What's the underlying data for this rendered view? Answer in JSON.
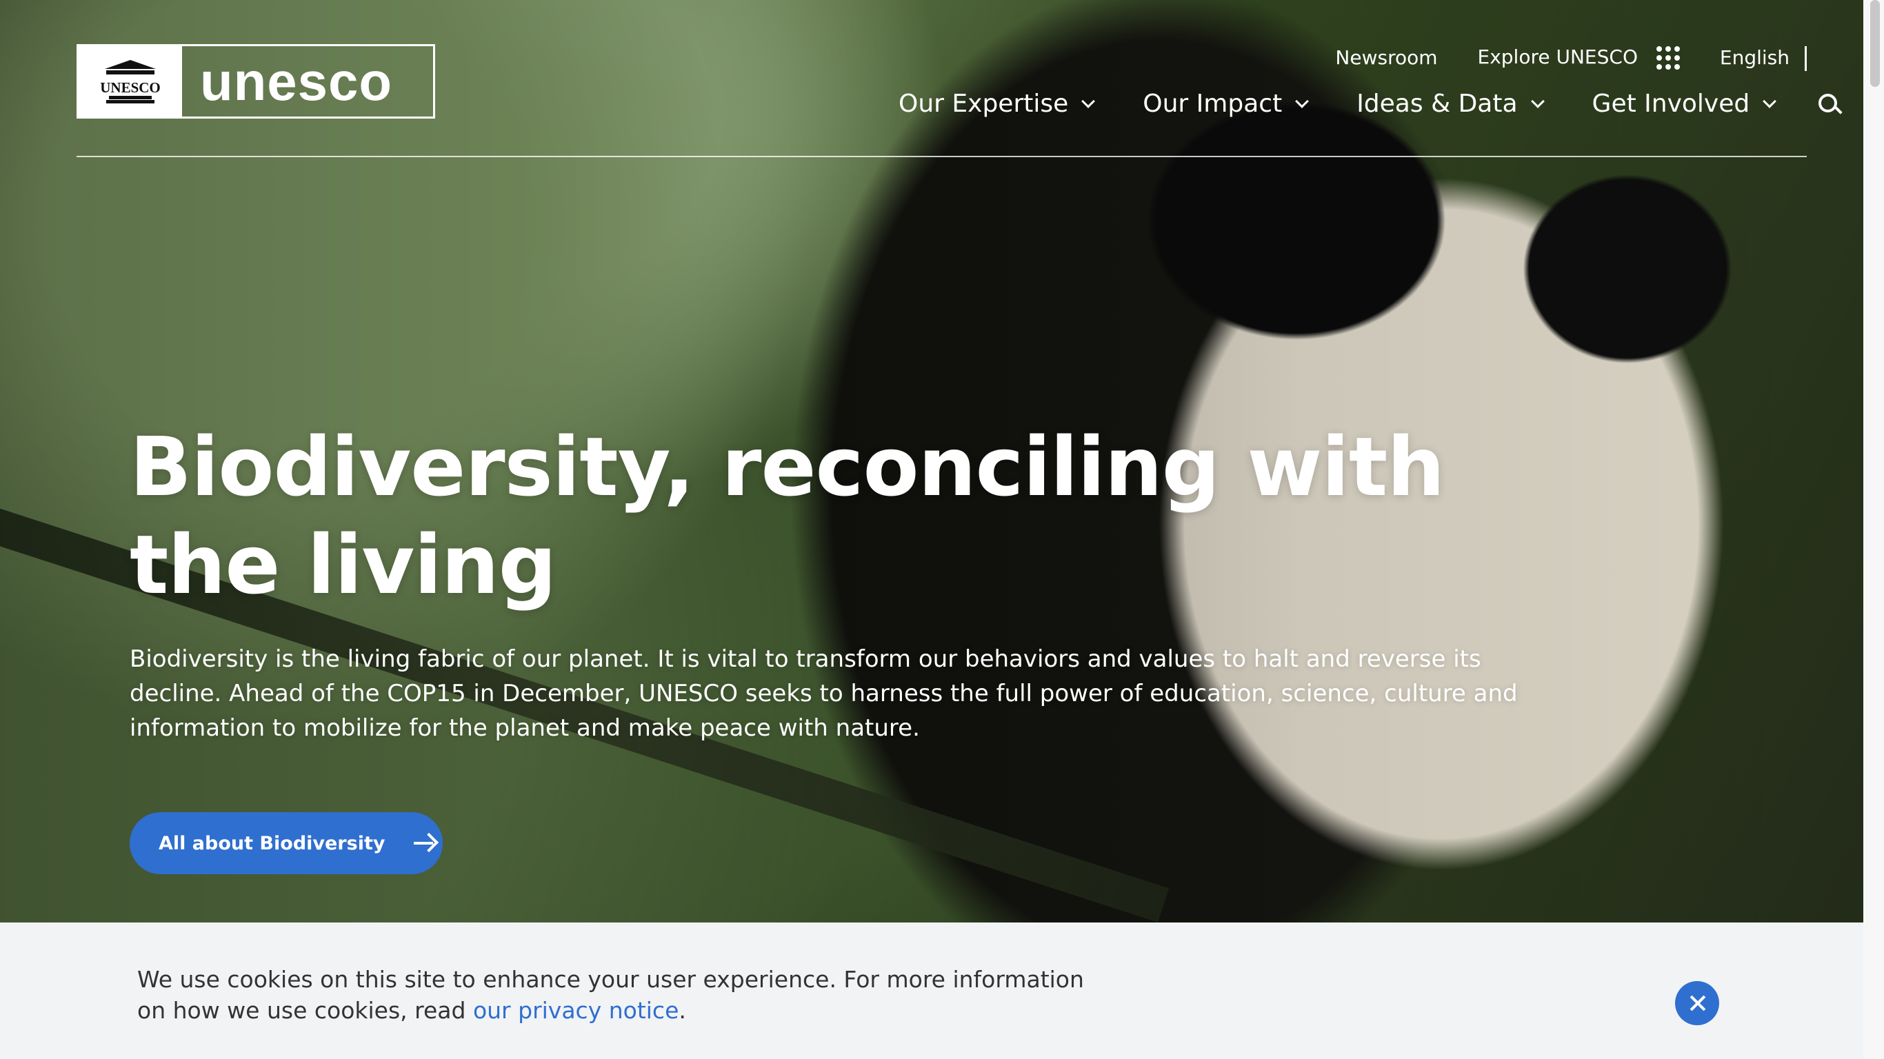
{
  "brand": {
    "logo_text": "unesco",
    "mark_text": "UNESCO"
  },
  "utility": {
    "newsroom": "Newsroom",
    "explore": "Explore UNESCO",
    "language": "English"
  },
  "nav": {
    "items": [
      {
        "label": "Our Expertise"
      },
      {
        "label": "Our Impact"
      },
      {
        "label": "Ideas & Data"
      },
      {
        "label": "Get Involved"
      }
    ],
    "search_icon": "search-icon"
  },
  "hero": {
    "title": "Biodiversity, reconciling with the living",
    "description": "Biodiversity is the living fabric of our planet. It is vital to transform our behaviors and values to halt and reverse its decline. Ahead of the COP15 in December, UNESCO seeks to harness the full power of education, science, culture and information to mobilize for the planet and make peace with nature.",
    "cta": "All about Biodiversity",
    "image": "giant panda in a tree"
  },
  "cookie": {
    "message_start": "We use cookies on this site to enhance your user experience. For more information on how we use cookies, read ",
    "privacy_link": "our privacy notice",
    "message_end": "."
  },
  "colors": {
    "accent": "#2f6fcf",
    "cookie_background": "#f2f3f5"
  }
}
